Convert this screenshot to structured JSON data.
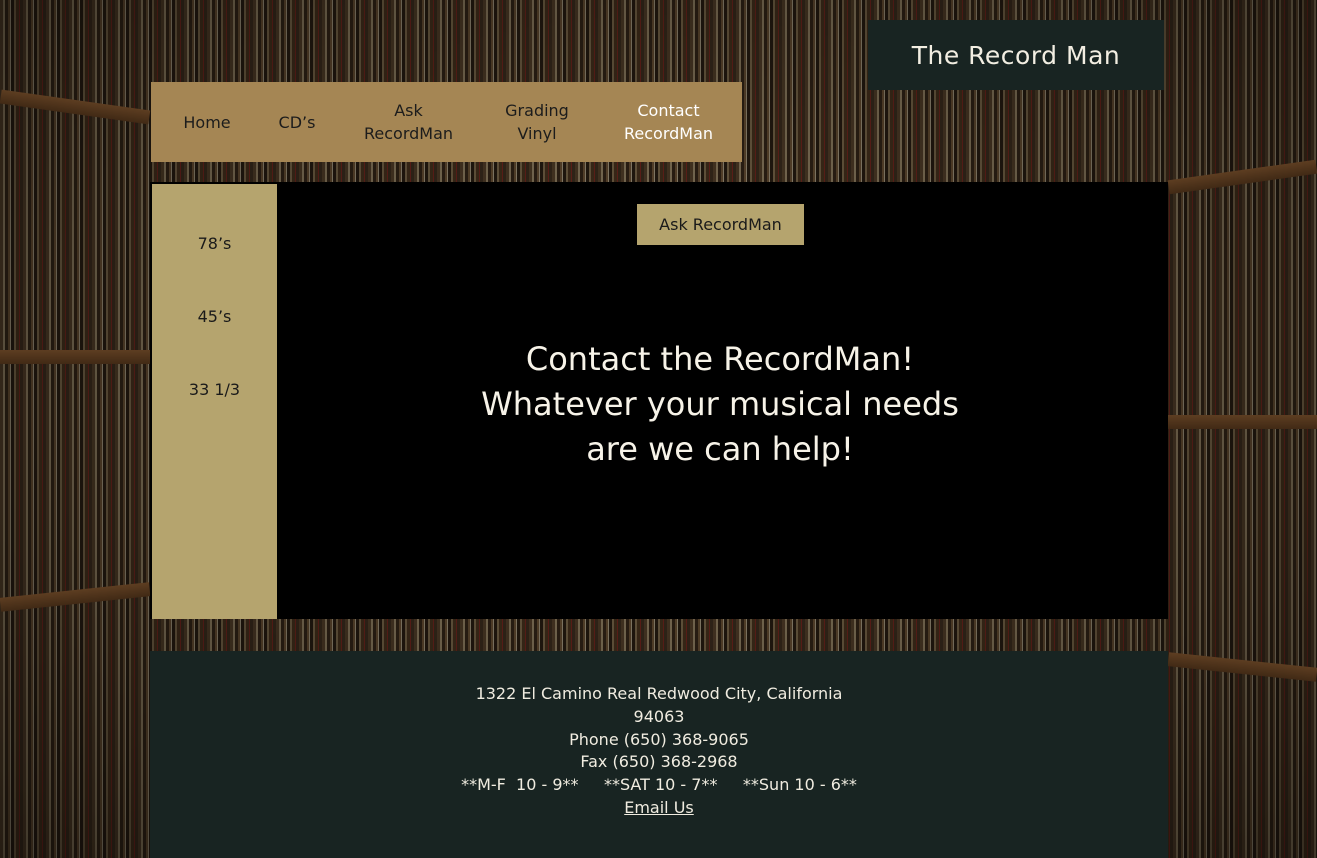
{
  "brand": {
    "title": "The Record Man"
  },
  "nav": {
    "items": [
      {
        "label_lines": [
          "Home"
        ]
      },
      {
        "label_lines": [
          "CD’s"
        ]
      },
      {
        "label_lines": [
          "Ask",
          "RecordMan"
        ]
      },
      {
        "label_lines": [
          "Grading",
          "Vinyl"
        ]
      },
      {
        "label_lines": [
          "Contact",
          "RecordMan"
        ]
      }
    ],
    "active": "Contact RecordMan"
  },
  "sidebar": {
    "items": [
      "78’s",
      "45’s",
      "33 1/3"
    ]
  },
  "main": {
    "ask_button": "Ask RecordMan",
    "headline_lines": [
      "Contact the RecordMan!",
      "Whatever your musical needs",
      "are we can help!"
    ]
  },
  "footer": {
    "address_line1": "1322 El Camino Real Redwood City, California",
    "address_line2": "94063",
    "phone": "Phone (650) 368-9065",
    "fax": "Fax (650) 368-2968",
    "hours": "**M-F  10 - 9**     **SAT 10 - 7**     **Sun 10 - 6**",
    "email_link": "Email Us"
  },
  "colors": {
    "nav_bg": "#a58654",
    "sidebar_bg": "#b5a46e",
    "dark_panel": "#182422",
    "main_bg": "#000000"
  }
}
